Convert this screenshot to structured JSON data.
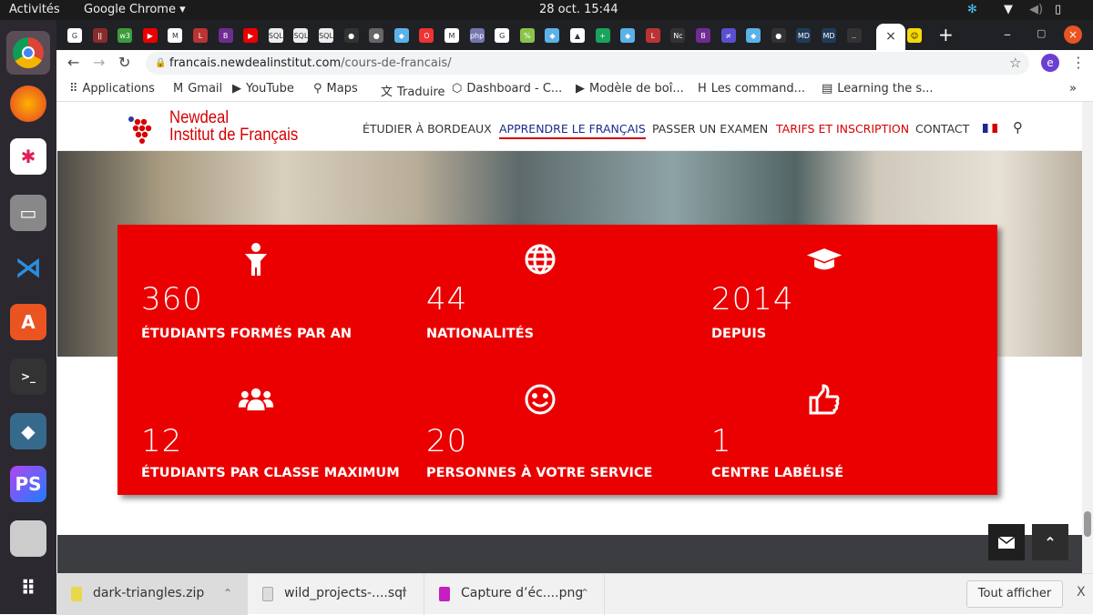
{
  "topbar": {
    "activities": "Activités",
    "app": "Google Chrome ▾",
    "clock": "28 oct.  15:44"
  },
  "browser": {
    "url_host": "francais.newdealinstitut.com",
    "url_path": "/cours-de-francais/",
    "profile": "e",
    "active_tab_close": "×",
    "new_tab": "+"
  },
  "tab_favicons": [
    "G",
    "ǀǀ",
    "w3",
    "▶",
    "M",
    "L",
    "B",
    "▶",
    "SQL",
    "SQL",
    "SQL",
    "●",
    "●",
    "◆",
    "O",
    "M",
    "php",
    "G",
    "%",
    "◆",
    "▲",
    "+",
    "◆",
    "L",
    "Nc",
    "B",
    "≠",
    "◆",
    "●",
    "MD",
    "MD",
    "‥"
  ],
  "bookmarks": [
    {
      "icon": "⠿",
      "label": "Applications"
    },
    {
      "icon": "M",
      "label": "Gmail"
    },
    {
      "icon": "▶",
      "label": "YouTube"
    },
    {
      "icon": "⚲",
      "label": "Maps"
    },
    {
      "icon": "文",
      "label": "Traduire"
    },
    {
      "icon": "⬡",
      "label": "Dashboard - C..."
    },
    {
      "icon": "▶",
      "label": "Modèle de boî..."
    },
    {
      "icon": "H",
      "label": "Les command..."
    },
    {
      "icon": "▤",
      "label": "Learning the s..."
    }
  ],
  "site": {
    "logo_line1": "Newdeal",
    "logo_line2": "Institut de Français",
    "nav": [
      "ÉTUDIER À BORDEAUX",
      "APPRENDRE LE FRANÇAIS",
      "PASSER UN EXAMEN",
      "TARIFS ET INSCRIPTION",
      "CONTACT"
    ],
    "stats": [
      {
        "icon": "person-icon",
        "value": "360",
        "label": "ÉTUDIANTS FORMÉS PAR AN"
      },
      {
        "icon": "globe-icon",
        "value": "44",
        "label": "NATIONALITÉS"
      },
      {
        "icon": "graduation-cap-icon",
        "value": "2014",
        "label": "DEPUIS"
      },
      {
        "icon": "users-icon",
        "value": "12",
        "label": "ÉTUDIANTS PAR CLASSE MAXIMUM"
      },
      {
        "icon": "smile-icon",
        "value": "20",
        "label": "PERSONNES À VOTRE SERVICE"
      },
      {
        "icon": "thumbs-up-icon",
        "value": "1",
        "label": "CENTRE LABÉLISÉ"
      }
    ],
    "colors": {
      "red": "#ea0000",
      "nav_active": "#1a2a8c"
    }
  },
  "downloads": {
    "items": [
      "dark-triangles.zip",
      "wild_projects-....sql",
      "Capture d’éc....png"
    ],
    "show_all": "Tout afficher",
    "close": "X"
  }
}
